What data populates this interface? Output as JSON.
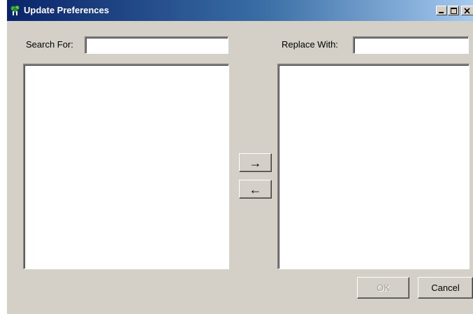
{
  "window": {
    "title": "Update Preferences",
    "icon": "app-tree-icon",
    "controls": {
      "minimize": "minimize-icon",
      "maximize": "maximize-icon",
      "close": "close-icon"
    }
  },
  "search": {
    "label": "Search For:",
    "value": ""
  },
  "replace": {
    "label": "Replace With:",
    "value": ""
  },
  "lists": {
    "left_items": [],
    "right_items": []
  },
  "transfer": {
    "right_glyph": "→",
    "right_icon": "arrow-right-icon",
    "left_glyph": "←",
    "left_icon": "arrow-left-icon"
  },
  "buttons": {
    "ok_label": "OK",
    "ok_enabled": false,
    "cancel_label": "Cancel"
  },
  "colors": {
    "titlebar_start": "#0a246a",
    "titlebar_end": "#a6caf0",
    "dialog_bg": "#d4d0c8"
  }
}
